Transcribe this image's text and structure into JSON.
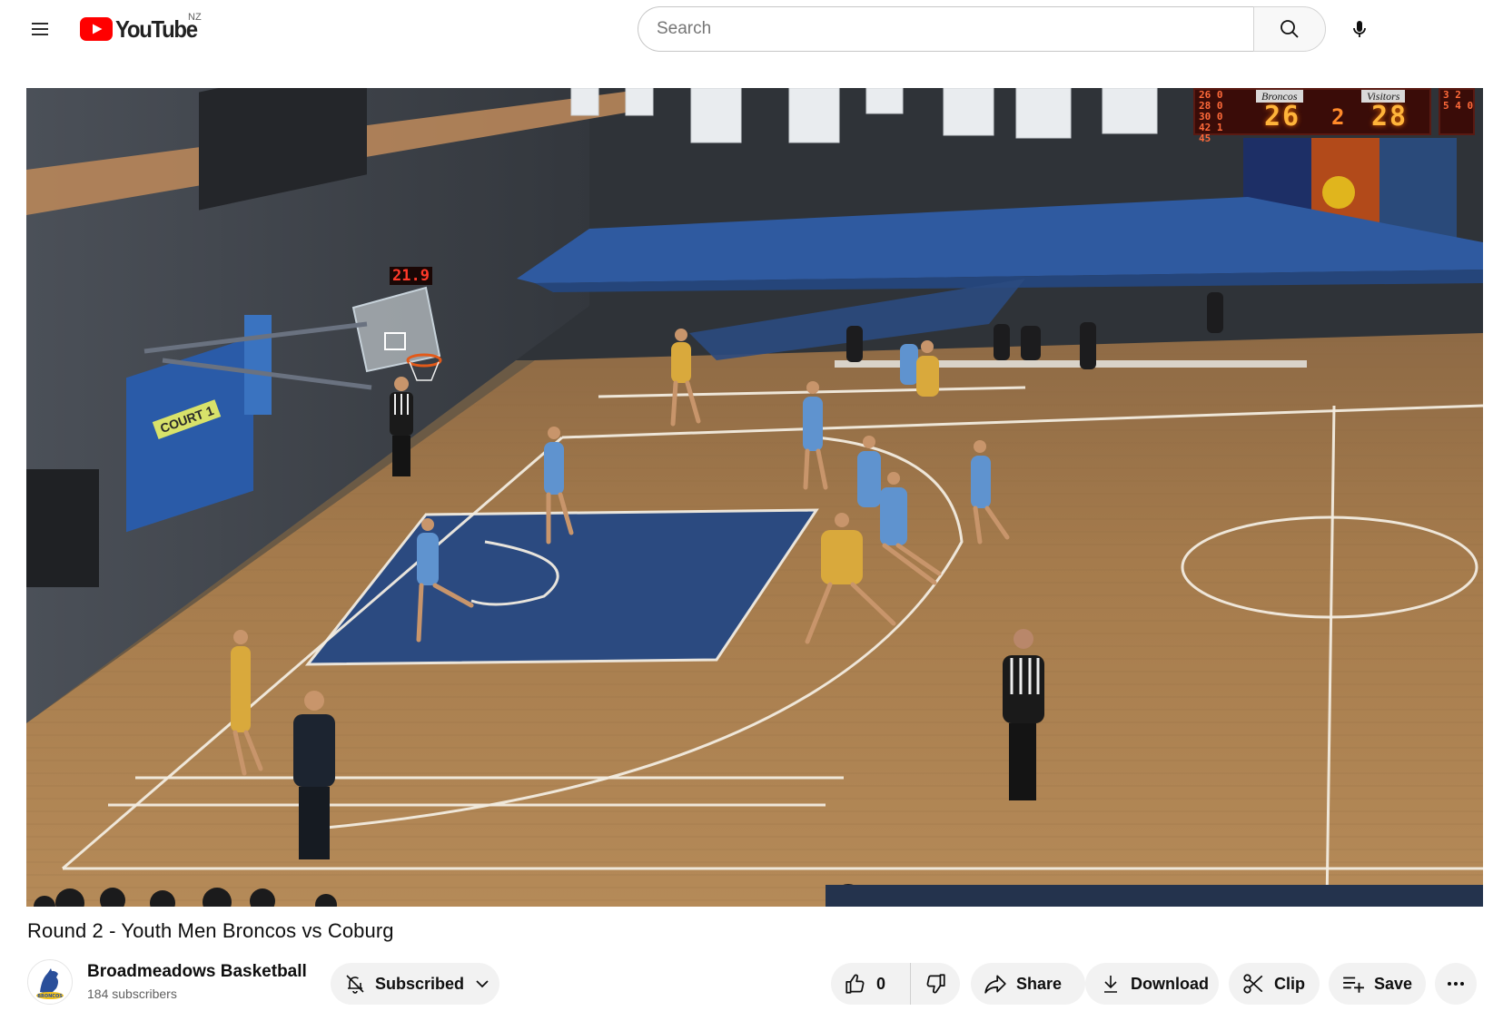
{
  "header": {
    "menu_icon": "hamburger-menu-icon",
    "logo_text": "YouTube",
    "country_code": "NZ",
    "search_placeholder": "Search",
    "search_value": "",
    "search_icon": "search-icon",
    "mic_icon": "microphone-icon"
  },
  "player": {
    "scoreboard_home_label": "Broncos",
    "scoreboard_away_label": "Visitors",
    "home_score": "26",
    "away_score": "28",
    "period": "2",
    "left_side_digits": "26 0\n28 0\n30 0\n42 1\n45",
    "right_side_digits": "3 2\n5 4 0",
    "shot_clock": "21.9",
    "court_sign": "COURT 1"
  },
  "video": {
    "title": "Round 2 - Youth Men Broncos vs Coburg"
  },
  "owner": {
    "channel_name": "Broadmeadows Basketball",
    "subscribers": "184 subscribers",
    "avatar_icon": "broncos-logo-icon"
  },
  "actions": {
    "subscribed_label": "Subscribed",
    "like_count": "0",
    "share_label": "Share",
    "download_label": "Download",
    "clip_label": "Clip",
    "save_label": "Save"
  },
  "colors": {
    "youtube_red": "#ff0000",
    "pill_bg": "#f2f2f2",
    "text_primary": "#0f0f0f",
    "text_secondary": "#606060",
    "court_wood": "#b0834f",
    "paint_blue": "#2b4a80"
  }
}
